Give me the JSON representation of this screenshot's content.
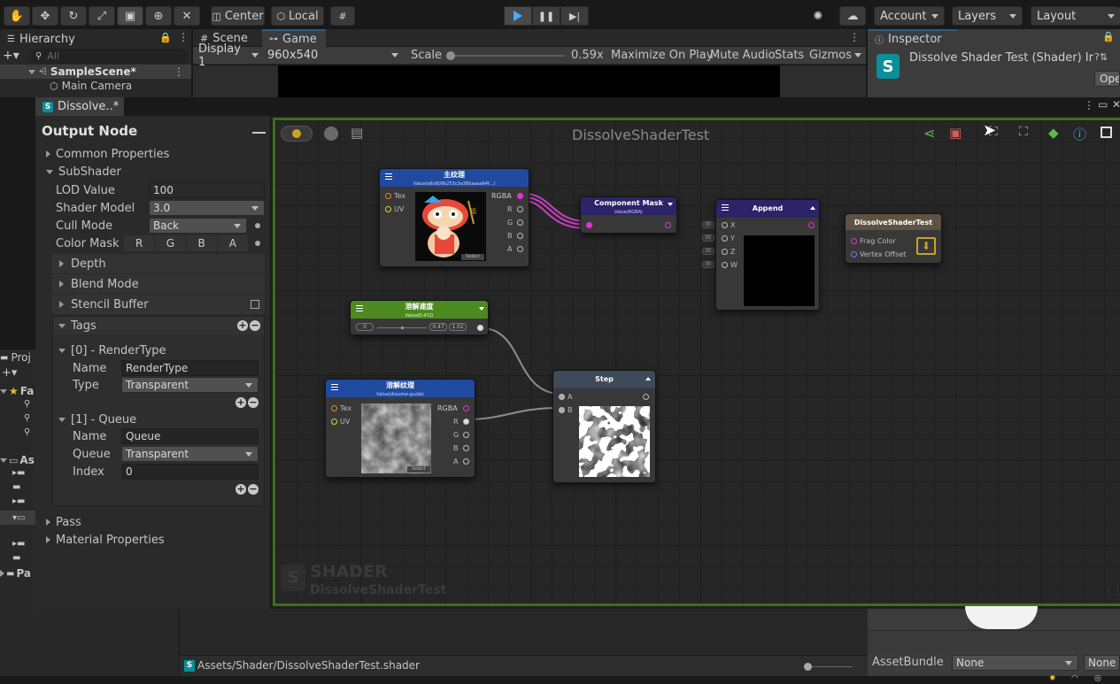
{
  "toolbar": {
    "pivot_label": "Center",
    "space_label": "Local",
    "account_label": "Account",
    "layers_label": "Layers",
    "layout_label": "Layout"
  },
  "hierarchy": {
    "tab_label": "Hierarchy",
    "search_placeholder": "All",
    "scene_name": "SampleScene*",
    "items": [
      "Main Camera"
    ]
  },
  "scene_tab": "Scene",
  "game_tab": "Game",
  "game_bar": {
    "display": "Display 1",
    "resolution": "960x540",
    "scale_label": "Scale",
    "scale_value": "0.59x",
    "maximize": "Maximize On Play",
    "mute": "Mute Audio",
    "stats": "Stats",
    "gizmos": "Gizmos"
  },
  "inspector": {
    "tab_label": "Inspector",
    "title": "Dissolve Shader Test (Shader) Ir",
    "open_label": "Ope"
  },
  "shader_window": {
    "tab_title": "Dissolve..*",
    "graph_title": "DissolveShaderTest",
    "watermark_title": "SHADER",
    "watermark_sub": "DissolveShaderTest"
  },
  "output_node": {
    "title": "Output Node",
    "common_properties": "Common Properties",
    "subshader": "SubShader",
    "lod_label": "LOD Value",
    "lod_value": "100",
    "shader_model_label": "Shader Model",
    "shader_model_value": "3.0",
    "cull_label": "Cull Mode",
    "cull_value": "Back",
    "color_mask_label": "Color Mask",
    "mask_channels": [
      "R",
      "G",
      "B",
      "A"
    ],
    "depth": "Depth",
    "blend": "Blend Mode",
    "stencil": "Stencil Buffer",
    "tags": "Tags",
    "tag0_title": "[0] - RenderType",
    "tag0_name_label": "Name",
    "tag0_name": "RenderType",
    "tag0_type_label": "Type",
    "tag0_type": "Transparent",
    "tag1_title": "[1] - Queue",
    "tag1_name_label": "Name",
    "tag1_name": "Queue",
    "tag1_queue_label": "Queue",
    "tag1_queue": "Transparent",
    "tag1_index_label": "Index",
    "tag1_index": "0",
    "pass": "Pass",
    "material_properties": "Material Properties"
  },
  "nodes": {
    "tex1": {
      "title": "主纹理",
      "subtitle": "Value(e6c609b253c2a38baaaa64f...)",
      "ports_in": [
        "Tex",
        "UV"
      ],
      "ports_out": [
        "RGBA",
        "R",
        "G",
        "B",
        "A"
      ],
      "select": "Select"
    },
    "mask": {
      "title": "Component Mask",
      "subtitle": "Value(RGBA)"
    },
    "append": {
      "title": "Append",
      "ports_in": [
        "X",
        "Y",
        "Z",
        "W"
      ],
      "chips": [
        "(0)",
        "(0)",
        "(0)",
        "(0)"
      ]
    },
    "output": {
      "title": "DissolveShaderTest",
      "ports_in": [
        "Frag Color",
        "Vertex Offset"
      ]
    },
    "speed": {
      "title": "溶解速度",
      "subtitle": "Value(0.472)",
      "min": "0",
      "value": "0.47",
      "max": "1.02"
    },
    "tex2": {
      "title": "溶解纹理",
      "subtitle": "Value(dissolve-guide)",
      "ports_in": [
        "Tex",
        "UV"
      ],
      "ports_out": [
        "RGBA",
        "R",
        "G",
        "B",
        "A"
      ],
      "select": "Select"
    },
    "step": {
      "title": "Step",
      "ports_in": [
        "A",
        "B"
      ]
    }
  },
  "project": {
    "tab_label": "Proj",
    "fav_label": "Fa",
    "assets_label": "As",
    "packages_label": "Pa"
  },
  "statusbar": {
    "path": "Assets/Shader/DissolveShaderTest.shader"
  },
  "asset_bundle": {
    "label": "AssetBundle",
    "value": "None",
    "value2": "None"
  },
  "colors": {
    "accent_blue": "#2c5d87",
    "graph_border": "#3d6e1e",
    "node_blue": "#1f4aa0",
    "node_green": "#4c8a20",
    "node_purple": "#2c2468",
    "node_gray": "#3c4a5a",
    "node_tan": "#5e5243",
    "port_magenta": "#e033d8"
  }
}
